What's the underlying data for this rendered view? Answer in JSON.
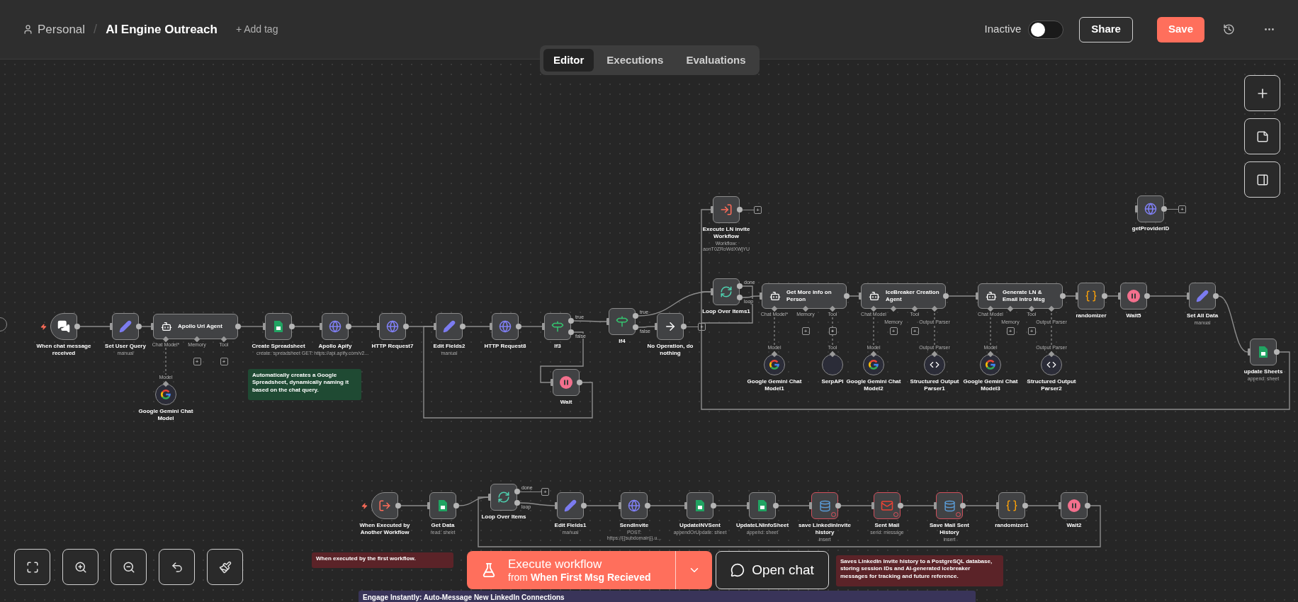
{
  "header": {
    "project": "Personal",
    "separator": "/",
    "workflow": "AI Engine Outreach",
    "add_tag": "+ Add tag",
    "status": {
      "label": "Inactive",
      "on": false
    },
    "share": "Share",
    "save": "Save"
  },
  "view_tabs": [
    {
      "label": "Editor",
      "selected": true
    },
    {
      "label": "Executions",
      "selected": false
    },
    {
      "label": "Evaluations",
      "selected": false
    }
  ],
  "canvas": {
    "nodes": [
      {
        "kind": "trigger",
        "label": "When chat message received",
        "error": false
      },
      {
        "kind": "action",
        "label": "Set User Query",
        "subtitle": "manual",
        "error": false
      },
      {
        "kind": "agent",
        "label": "Apollo Url Agent",
        "error": false,
        "ports": [
          {
            "label": "Chat Model*"
          },
          {
            "label": "Memory",
            "add_button": "+"
          },
          {
            "label": "Tool",
            "add_button": "+"
          }
        ]
      },
      {
        "kind": "action",
        "label": "Create Spreadsheet",
        "subtitle": "create: spreadsheet",
        "error": false
      },
      {
        "kind": "action",
        "label": "Apollo Apify",
        "subtitle": "GET: https://api.apify.com/v2...",
        "error": false
      },
      {
        "kind": "action",
        "label": "HTTP Request7",
        "error": false
      },
      {
        "kind": "action",
        "label": "Edit Fields2",
        "subtitle": "manual",
        "error": false
      },
      {
        "kind": "action",
        "label": "HTTP Request8",
        "error": false
      },
      {
        "kind": "action",
        "label": "If3",
        "outputs": [
          "true",
          "false"
        ],
        "error": false
      },
      {
        "kind": "action",
        "label": "If4",
        "outputs": [
          "true",
          "false"
        ],
        "error": false
      },
      {
        "kind": "action",
        "label": "No Operation, do nothing",
        "error": false,
        "add_button": "+"
      },
      {
        "kind": "action",
        "label": "Wait",
        "error": false
      },
      {
        "kind": "sub",
        "label": "Google Gemini Chat Model",
        "port_label": "Model"
      },
      {
        "kind": "action",
        "label": "Execute LN invite Workflow",
        "subtitle": "Workflow: aonT0ZRoWdXWjYU",
        "error": false,
        "add_button": "+"
      },
      {
        "kind": "action",
        "label": "Loop Over Items1",
        "outputs": [
          "done",
          "loop"
        ],
        "error": false
      },
      {
        "kind": "agent",
        "label": "Get More info on Person",
        "error": false,
        "ports": [
          {
            "label": "Chat Model*"
          },
          {
            "label": "Memory",
            "add_button": "+"
          },
          {
            "label": "Tool",
            "add_button": "+"
          }
        ]
      },
      {
        "kind": "agent",
        "label": "IceBreaker Creation Agent",
        "error": false,
        "ports": [
          {
            "label": "Chat Model"
          },
          {
            "label": "Memory",
            "add_button": "+"
          },
          {
            "label": "Tool",
            "add_button": "+"
          },
          {
            "label": "Output Parser"
          }
        ]
      },
      {
        "kind": "agent",
        "label": "Generate LN & Email Intro Msg",
        "error": false,
        "ports": [
          {
            "label": "Chat Model"
          },
          {
            "label": "Memory",
            "add_button": "+"
          },
          {
            "label": "Tool",
            "add_button": "+"
          },
          {
            "label": "Output Parser"
          }
        ]
      },
      {
        "kind": "action",
        "label": "randomizer",
        "error": false
      },
      {
        "kind": "action",
        "label": "Wait5",
        "error": false
      },
      {
        "kind": "action",
        "label": "Set All Data",
        "subtitle": "manual",
        "error": false
      },
      {
        "kind": "action",
        "label": "update Sheets",
        "subtitle": "append: sheet",
        "error": false
      },
      {
        "kind": "action",
        "label": "getProviderID",
        "error": false,
        "add_button": "+"
      },
      {
        "kind": "sub",
        "label": "Google Gemini Chat Model1",
        "port_label": "Model"
      },
      {
        "kind": "sub",
        "label": "SerpAPI",
        "port_label": "Tool"
      },
      {
        "kind": "sub",
        "label": "Google Gemini Chat Model2",
        "port_label": "Model"
      },
      {
        "kind": "sub",
        "label": "Structured Output Parser1",
        "port_label": "Output Parser"
      },
      {
        "kind": "sub",
        "label": "Google Gemini Chat Model3",
        "port_label": "Model"
      },
      {
        "kind": "sub",
        "label": "Structured Output Parser2",
        "port_label": "Output Parser"
      },
      {
        "kind": "trigger",
        "label": "When Executed by Another Workflow",
        "error": false
      },
      {
        "kind": "action",
        "label": "Get Data",
        "subtitle": "read: sheet",
        "error": false
      },
      {
        "kind": "action",
        "label": "Loop Over Items",
        "outputs": [
          "done",
          "loop"
        ],
        "error": false,
        "add_button": "+"
      },
      {
        "kind": "action",
        "label": "Edit Fields1",
        "subtitle": "manual",
        "error": false
      },
      {
        "kind": "action",
        "label": "SendInvite",
        "subtitle": "POST: https://{{subdomain}}.u...",
        "error": false
      },
      {
        "kind": "action",
        "label": "UpdateINVSent",
        "subtitle": "appendOrUpdate: sheet",
        "error": false
      },
      {
        "kind": "action",
        "label": "UpdateLNInfoSheet",
        "subtitle": "append: sheet",
        "error": false
      },
      {
        "kind": "action",
        "label": "save LinkedinInvite history",
        "subtitle": "insert",
        "error": true
      },
      {
        "kind": "action",
        "label": "Sent Mail",
        "subtitle": "send: message",
        "error": true
      },
      {
        "kind": "action",
        "label": "Save Mail Sent History",
        "subtitle": "insert",
        "error": true
      },
      {
        "kind": "action",
        "label": "randomizer1",
        "error": false
      },
      {
        "kind": "action",
        "label": "Wait2",
        "error": false
      }
    ],
    "sticky_notes": [
      {
        "text": "Automatically creates a Google Spreadsheet, dynamically naming it based on the chat query.",
        "color": "#1f4a33"
      },
      {
        "text": "When executed by the first workflow.",
        "color": "#5b2328"
      },
      {
        "text": "Saves LinkedIn Invite history to a PostgreSQL database, storing session IDs and AI-generated icebreaker messages for tracking and future reference.",
        "color": "#5b2328"
      },
      {
        "text": "Engage Instantly: Auto-Message New LinkedIn Connections",
        "color": "#393459"
      }
    ]
  },
  "execute_button": {
    "title": "Execute workflow",
    "subtitle": "from **When First Msg Recieved**"
  },
  "open_chat": "Open chat"
}
